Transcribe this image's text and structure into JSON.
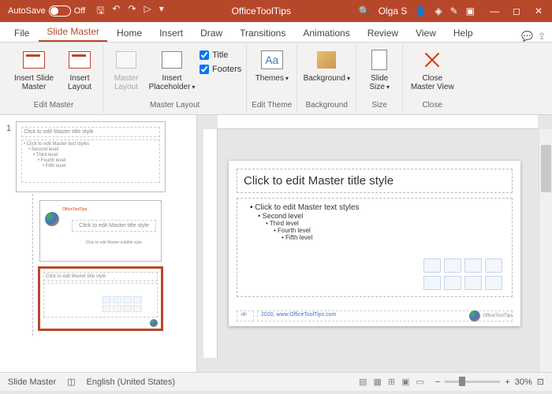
{
  "titlebar": {
    "autosave_label": "AutoSave",
    "autosave_state": "Off",
    "app_title": "OfficeToolTips",
    "user_name": "Olga S"
  },
  "tabs": {
    "file": "File",
    "slide_master": "Slide Master",
    "home": "Home",
    "insert": "Insert",
    "draw": "Draw",
    "transitions": "Transitions",
    "animations": "Animations",
    "review": "Review",
    "view": "View",
    "help": "Help"
  },
  "ribbon": {
    "insert_slide_master": "Insert Slide Master",
    "insert_layout": "Insert Layout",
    "edit_master_group": "Edit Master",
    "master_layout": "Master Layout",
    "insert_placeholder": "Insert Placeholder",
    "title_check": "Title",
    "footers_check": "Footers",
    "master_layout_group": "Master Layout",
    "themes": "Themes",
    "edit_theme_group": "Edit Theme",
    "background": "Background",
    "background_group": "Background",
    "slide_size": "Slide Size",
    "size_group": "Size",
    "close_master": "Close Master View",
    "close_group": "Close"
  },
  "thumbnails": {
    "number": "1",
    "master_title": "Click to edit Master title style",
    "master_body": "• Click to edit Master text styles",
    "l2": "• Second level",
    "l3": "• Third level",
    "l4": "• Fourth level",
    "l5": "• Fifth level",
    "layout1_brand": "OfficeToolTips",
    "layout1_title": "Click to edit Master title style",
    "layout1_sub": "Click to edit Master subtitle style",
    "layout2_title": "Click to edit Master title style"
  },
  "slide": {
    "title": "Click to edit Master title style",
    "l1": "Click to edit Master text styles",
    "l2": "Second level",
    "l3": "Third level",
    "l4": "Fourth level",
    "l5": "Fifth level",
    "footer_num": "‹#›",
    "footer_text": "2020, www.OfficeToolTips.com",
    "brand": "OfficeToolTips"
  },
  "status": {
    "view": "Slide Master",
    "lang": "English (United States)",
    "zoom": "30%"
  }
}
